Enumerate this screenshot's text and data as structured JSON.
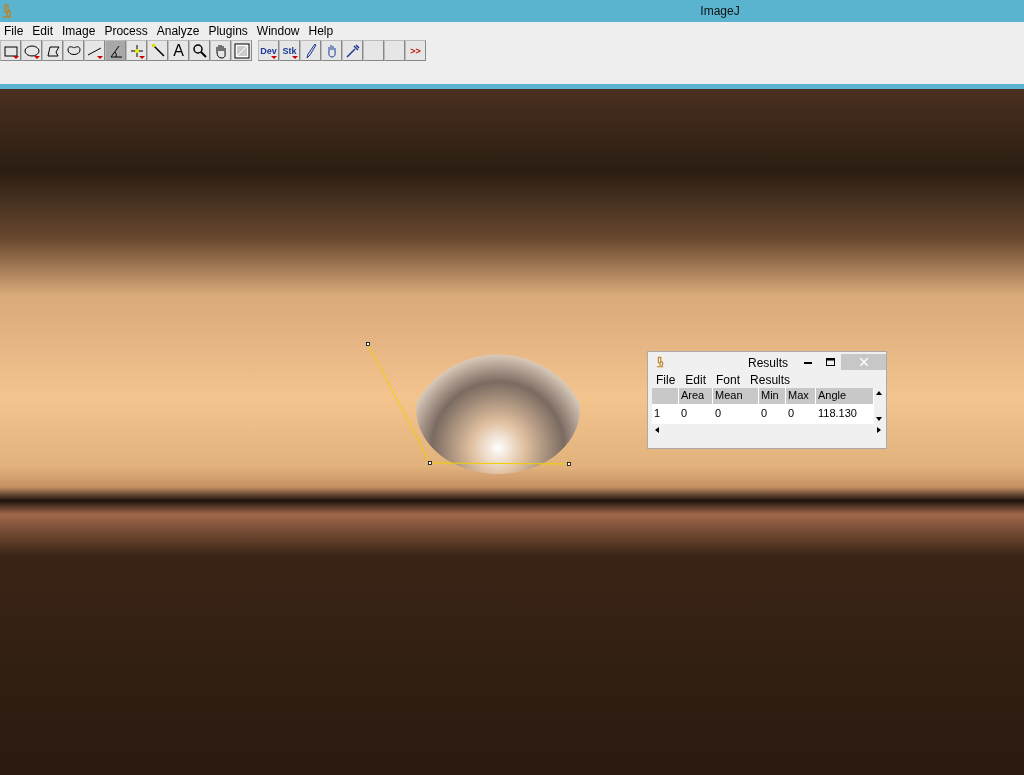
{
  "window": {
    "title": "ImageJ"
  },
  "menu": [
    "File",
    "Edit",
    "Image",
    "Process",
    "Analyze",
    "Plugins",
    "Window",
    "Help"
  ],
  "tools": [
    {
      "kind": "icon",
      "selected": false
    },
    {
      "kind": "icon",
      "selected": false
    },
    {
      "kind": "icon",
      "selected": false
    },
    {
      "kind": "icon",
      "selected": false
    },
    {
      "kind": "icon",
      "selected": false
    },
    {
      "kind": "icon",
      "selected": true
    },
    {
      "kind": "icon",
      "selected": false
    },
    {
      "kind": "icon",
      "selected": false
    },
    {
      "kind": "text",
      "label": "A",
      "selected": false
    },
    {
      "kind": "icon",
      "selected": false
    },
    {
      "kind": "icon",
      "selected": false
    },
    {
      "kind": "icon",
      "selected": false
    },
    {
      "kind": "gap"
    },
    {
      "kind": "text",
      "label": "Dev",
      "selected": false
    },
    {
      "kind": "text",
      "label": "Stk",
      "selected": false
    },
    {
      "kind": "icon",
      "selected": false
    },
    {
      "kind": "icon",
      "selected": false
    },
    {
      "kind": "icon",
      "selected": false
    },
    {
      "kind": "blank"
    },
    {
      "kind": "blank"
    },
    {
      "kind": "text",
      "label": ">>",
      "selected": false
    }
  ],
  "results": {
    "title": "Results",
    "menu": [
      "File",
      "Edit",
      "Font",
      "Results"
    ],
    "columns": [
      "",
      "Area",
      "Mean",
      "Min",
      "Max",
      "Angle"
    ],
    "rows": [
      [
        "1",
        "0",
        "0",
        "0",
        "0",
        "118.130"
      ]
    ]
  }
}
